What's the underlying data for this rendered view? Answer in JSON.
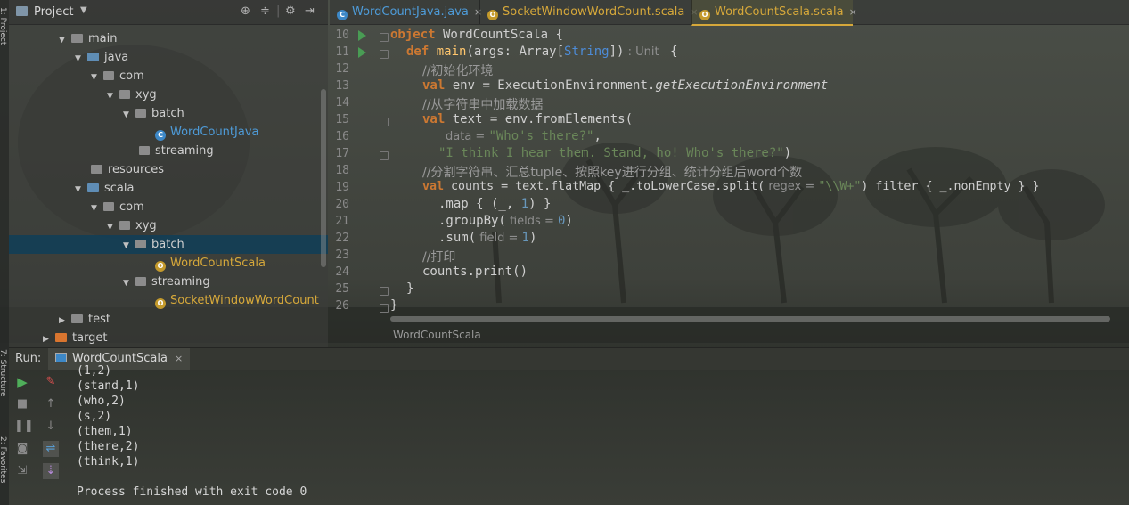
{
  "left_stripe": {
    "project_label": "1: Project",
    "structure_label": "7: Structure",
    "favorites_label": "2: Favorites"
  },
  "project_panel": {
    "title": "Project",
    "header_icons": [
      "target-icon",
      "collapse-icon",
      "gear-icon",
      "hide-icon"
    ],
    "tree": [
      {
        "label": "main",
        "type": "folder",
        "expanded": true
      },
      {
        "label": "java",
        "type": "source-folder",
        "expanded": true
      },
      {
        "label": "com",
        "type": "package",
        "expanded": true
      },
      {
        "label": "xyg",
        "type": "package",
        "expanded": true
      },
      {
        "label": "batch",
        "type": "package",
        "expanded": true
      },
      {
        "label": "WordCountJava",
        "type": "java-class"
      },
      {
        "label": "streaming",
        "type": "package",
        "expanded": false
      },
      {
        "label": "resources",
        "type": "folder"
      },
      {
        "label": "scala",
        "type": "source-folder",
        "expanded": true
      },
      {
        "label": "com",
        "type": "package",
        "expanded": true
      },
      {
        "label": "xyg",
        "type": "package",
        "expanded": true
      },
      {
        "label": "batch",
        "type": "package",
        "expanded": true,
        "selected": true
      },
      {
        "label": "WordCountScala",
        "type": "scala-object"
      },
      {
        "label": "streaming",
        "type": "package",
        "expanded": true
      },
      {
        "label": "SocketWindowWordCount",
        "type": "scala-object"
      },
      {
        "label": "test",
        "type": "folder",
        "expanded": false
      },
      {
        "label": "target",
        "type": "folder",
        "expanded": false
      }
    ]
  },
  "tabs": [
    {
      "label": "WordCountJava.java",
      "close": "×"
    },
    {
      "label": "SocketWindowWordCount.scala",
      "close": "×"
    },
    {
      "label": "WordCountScala.scala",
      "close": "×",
      "active": true
    }
  ],
  "editor": {
    "line_numbers": [
      "10",
      "11",
      "12",
      "13",
      "14",
      "15",
      "16",
      "17",
      "18",
      "19",
      "20",
      "21",
      "22",
      "23",
      "24",
      "25",
      "26"
    ],
    "code": {
      "l10_kw": "object",
      "l10_name": " WordCountScala {",
      "l11_kw": "def",
      "l11_fn": " main",
      "l11_a": "(args: Array[",
      "l11_type": "String",
      "l11_b": "])",
      "l11_hint": " : Unit ",
      "l11_c": " {",
      "l12": "//初始化环境",
      "l13_kw": "val",
      "l13_a": " env = ExecutionEnvironment.",
      "l13_it": "getExecutionEnvironment",
      "l14": "//从字符串中加载数据",
      "l15_kw": "val",
      "l15_a": " text = env.fromElements(",
      "l16_hint": "data = ",
      "l16_str": "\"Who's there?\"",
      "l16_b": ",",
      "l17_str": "\"I think I hear them. Stand, ho! Who's there?\"",
      "l17_b": ")",
      "l18": "//分割字符串、汇总tuple、按照key进行分组、统计分组后word个数",
      "l19_kw": "val",
      "l19_a": " counts = text.flatMap { _.toLowerCase.split(",
      "l19_hint": " regex = ",
      "l19_str": "\"\\\\W+\"",
      "l19_b": ") ",
      "l19_ul1": "filter",
      "l19_c": " { _.",
      "l19_ul2": "nonEmpty",
      "l19_d": " } }",
      "l20_a": ".map { (_, ",
      "l20_num": "1",
      "l20_b": ") }",
      "l21_a": ".groupBy(",
      "l21_hint": " fields = ",
      "l21_num": "0",
      "l21_b": ")",
      "l22_a": ".sum(",
      "l22_hint": " field = ",
      "l22_num": "1",
      "l22_b": ")",
      "l23": "//打印",
      "l24": "counts.print()",
      "l25": "}",
      "l26": "}"
    },
    "breadcrumb": "WordCountScala"
  },
  "run": {
    "label": "Run:",
    "tab_label": "WordCountScala",
    "tab_close": "×",
    "output": [
      "(1,2)",
      "(stand,1)",
      "(who,2)",
      "(s,2)",
      "(them,1)",
      "(there,2)",
      "(think,1)",
      "",
      "Process finished with exit code 0"
    ]
  },
  "colors": {
    "keyword": "#cc7832",
    "string": "#6a8759",
    "number": "#6897bb",
    "function": "#ffc66d",
    "selection": "#123e56",
    "run_green": "#499c54"
  }
}
